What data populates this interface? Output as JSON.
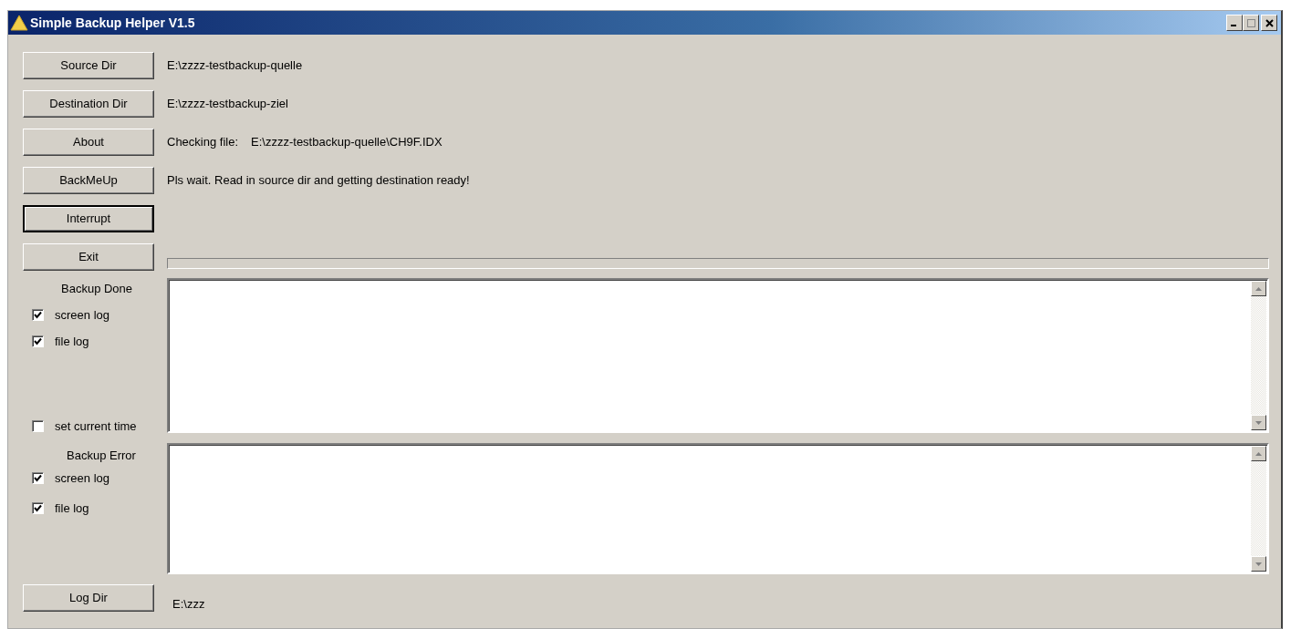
{
  "window": {
    "title": "Simple Backup Helper V1.5"
  },
  "rows": [
    {
      "button": "Source Dir",
      "default": false,
      "value": "E:\\zzzz-testbackup-quelle"
    },
    {
      "button": "Destination Dir",
      "default": false,
      "value": "E:\\zzzz-testbackup-ziel"
    },
    {
      "button": "About",
      "default": false,
      "label": "Checking file:",
      "value": "E:\\zzzz-testbackup-quelle\\CH9F.IDX"
    },
    {
      "button": "BackMeUp",
      "default": false,
      "value": "Pls wait. Read in source dir and getting destination ready!"
    },
    {
      "button": "Interrupt",
      "default": true
    },
    {
      "button": "Exit",
      "default": false
    }
  ],
  "logs": [
    {
      "title": "Backup Done",
      "options": [
        {
          "label": "screen log",
          "checked": true
        },
        {
          "label": "file log",
          "checked": true
        }
      ],
      "bottom_option": {
        "label": "set current time",
        "checked": false
      }
    },
    {
      "title": "Backup Error",
      "options": [
        {
          "label": "screen log",
          "checked": true
        },
        {
          "label": "file log",
          "checked": true
        }
      ]
    }
  ],
  "log_dir": {
    "button": "Log Dir",
    "path": "E:\\zzz"
  }
}
